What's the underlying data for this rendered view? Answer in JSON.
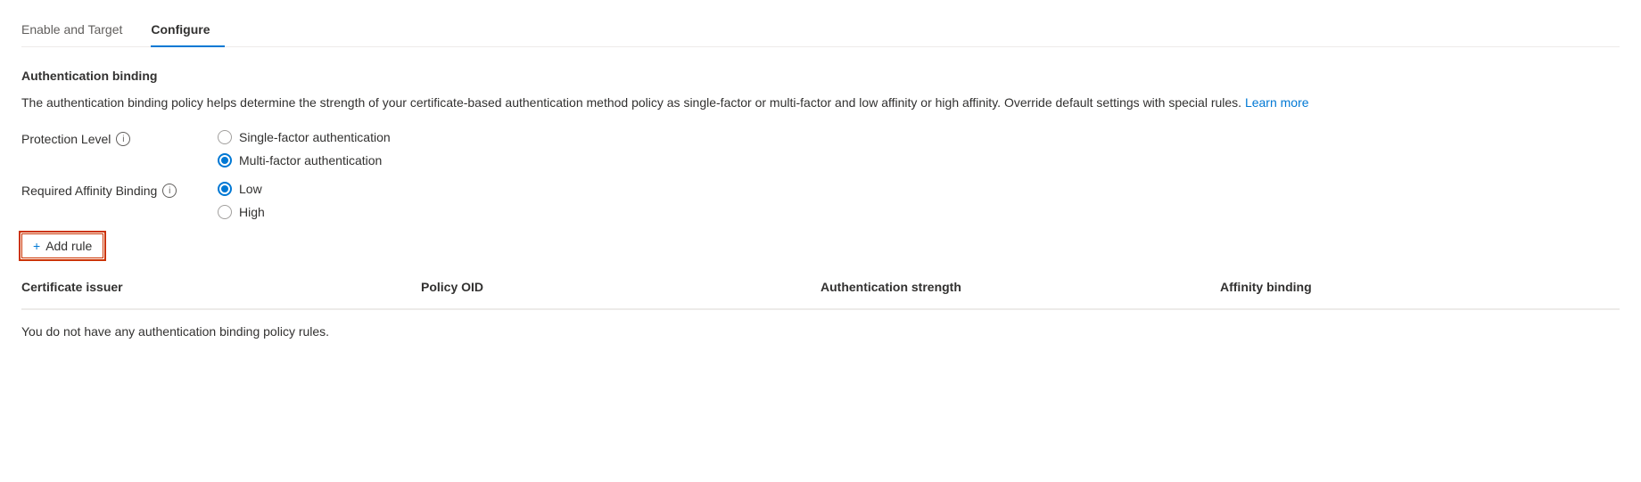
{
  "tabs": [
    {
      "id": "enable-target",
      "label": "Enable and Target",
      "active": false
    },
    {
      "id": "configure",
      "label": "Configure",
      "active": true
    }
  ],
  "section": {
    "title": "Authentication binding",
    "description": "The authentication binding policy helps determine the strength of your certificate-based authentication method policy as single-factor or multi-factor and low affinity or high affinity. Override default settings with special rules.",
    "learn_more_label": "Learn more"
  },
  "protection_level": {
    "label": "Protection Level",
    "options": [
      {
        "id": "single-factor",
        "label": "Single-factor authentication",
        "selected": false
      },
      {
        "id": "multi-factor",
        "label": "Multi-factor authentication",
        "selected": true
      }
    ]
  },
  "affinity_binding": {
    "label": "Required Affinity Binding",
    "options": [
      {
        "id": "low",
        "label": "Low",
        "selected": true
      },
      {
        "id": "high",
        "label": "High",
        "selected": false
      }
    ]
  },
  "add_rule_button": "+ Add rule",
  "table": {
    "columns": [
      "Certificate issuer",
      "Policy OID",
      "Authentication strength",
      "Affinity binding"
    ],
    "empty_message": "You do not have any authentication binding policy rules."
  }
}
